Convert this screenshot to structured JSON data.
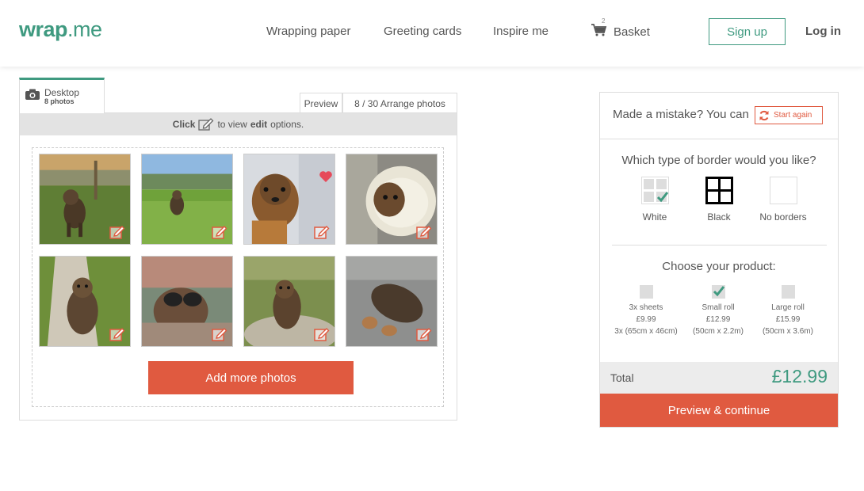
{
  "header": {
    "logo_main": "wrap",
    "logo_dot": ".me",
    "nav": [
      "Wrapping paper",
      "Greeting cards",
      "Inspire me"
    ],
    "basket_label": "Basket",
    "basket_count": "2",
    "signup_label": "Sign up",
    "login_label": "Log in"
  },
  "editor": {
    "source_tab": {
      "label": "Desktop",
      "count": "8 photos"
    },
    "preview_label": "Preview",
    "arrange_label": "8 / 30 Arrange photos",
    "info": {
      "click": "Click",
      "to_view": "to view",
      "edit": "edit",
      "options": "options."
    },
    "photos": [
      {
        "name": "photo-1",
        "desc": "dog-in-field-sunset"
      },
      {
        "name": "photo-2",
        "desc": "dog-running-grass"
      },
      {
        "name": "photo-3",
        "desc": "puppy-with-heart",
        "favorite": true
      },
      {
        "name": "photo-4",
        "desc": "dog-in-blanket"
      },
      {
        "name": "photo-5",
        "desc": "dog-on-path"
      },
      {
        "name": "photo-6",
        "desc": "dog-with-sunglasses"
      },
      {
        "name": "photo-7",
        "desc": "dog-on-rocks"
      },
      {
        "name": "photo-8",
        "desc": "dog-sleeping-sofa"
      }
    ],
    "add_more_label": "Add more photos"
  },
  "sidebar": {
    "mistake_text": "Made a mistake? You can",
    "start_again_label": "Start again",
    "border_question": "Which type of border would you like?",
    "borders": [
      {
        "label": "White",
        "selected": true
      },
      {
        "label": "Black",
        "selected": false
      },
      {
        "label": "No borders",
        "selected": false
      }
    ],
    "product_question": "Choose your product:",
    "products": [
      {
        "name": "3x sheets",
        "price": "£9.99",
        "size": "3x (65cm x 46cm)",
        "selected": false
      },
      {
        "name": "Small roll",
        "price": "£12.99",
        "size": "(50cm x 2.2m)",
        "selected": true
      },
      {
        "name": "Large roll",
        "price": "£15.99",
        "size": "(50cm x 3.6m)",
        "selected": false
      }
    ],
    "total_label": "Total",
    "total_price": "£12.99",
    "preview_continue_label": "Preview & continue"
  },
  "colors": {
    "brand": "#3f9a80",
    "accent": "#e05a40",
    "panel_grey": "#ececec"
  }
}
